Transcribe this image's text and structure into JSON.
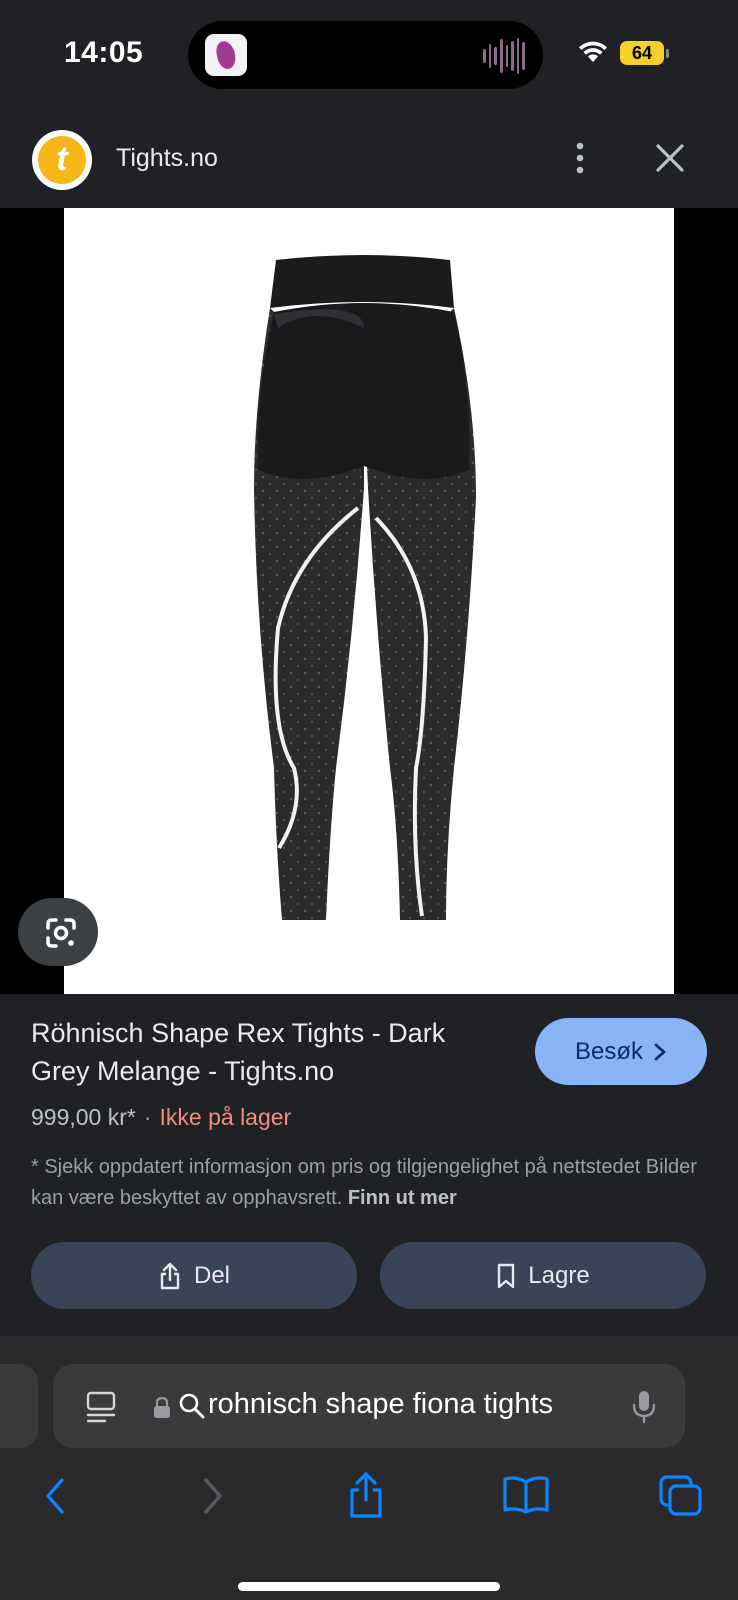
{
  "status_bar": {
    "time": "14:05",
    "battery": "64",
    "wifi_icon": "wifi-icon",
    "island_app_icon": "music-app-icon",
    "accent_battery": "#f4cf27"
  },
  "header": {
    "logo_letter": "t",
    "site_name": "Tights.no",
    "more_icon": "more-vertical-icon",
    "close_icon": "close-icon",
    "logo_color": "#f8b619"
  },
  "image": {
    "lens_icon": "google-lens-icon"
  },
  "details": {
    "title": "Röhnisch Shape Rex Tights - Dark Grey Melange - Tights.no",
    "visit_label": "Besøk",
    "price": "999,00 kr*",
    "separator": "·",
    "stock": "Ikke på lager",
    "disclaimer": "* Sjekk oppdatert informasjon om pris og tilgjengelighet på nettstedet Bilder kan være beskyttet av opphavsrett.",
    "learn_more": "Finn ut mer",
    "share_label": "Del",
    "save_label": "Lagre",
    "accent_visit": "#8ab4f8",
    "stock_color": "#f28b82"
  },
  "browser": {
    "address": "rohnisch shape fiona tights",
    "icons": [
      "reader-icon",
      "lock-icon",
      "search-icon",
      "mic-icon",
      "back-icon",
      "forward-icon",
      "share-icon",
      "bookmarks-icon",
      "tabs-icon"
    ],
    "accent": "#0a84ff"
  }
}
